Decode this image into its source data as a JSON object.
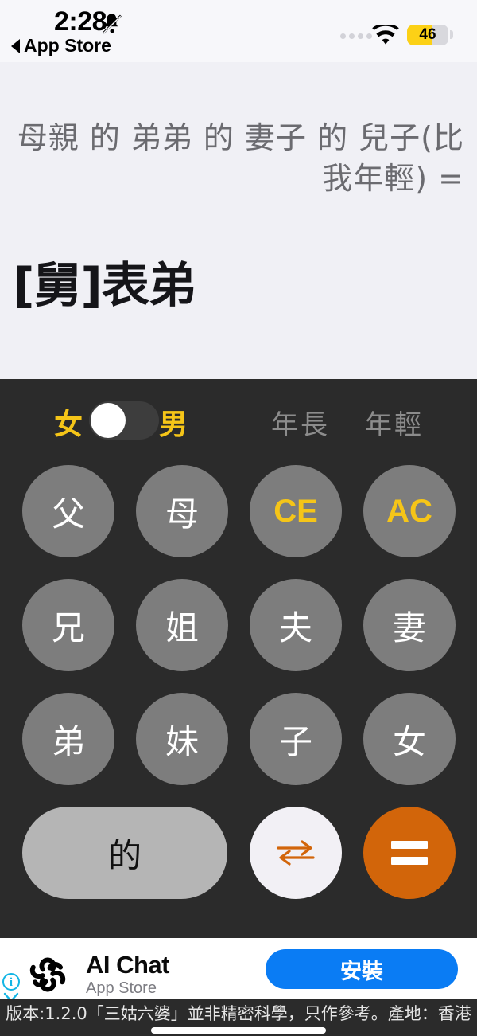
{
  "statusbar": {
    "time": "2:28",
    "bell_icon": "bell-slash-icon",
    "back_label": "App Store",
    "back_icon": "triangle-left-icon",
    "wifi_icon": "wifi-icon",
    "battery_percent": "46",
    "battery_fill_color": "#fcd116",
    "signal_dots": 4
  },
  "display": {
    "expression": "母親 的 弟弟 的 妻子 的 兒子(比我年輕) =",
    "result": "[舅]表弟",
    "background_color": "#f0f0f5",
    "expression_color": "#6b6b70",
    "result_color": "#151519"
  },
  "toggle_row": {
    "female_label": "女",
    "male_label": "男",
    "switch_position": "left",
    "older_label": "年長",
    "younger_label": "年輕",
    "active_color": "#f5c518",
    "inactive_color": "#8c8c8c"
  },
  "keypad": {
    "background_color": "#2b2b2b",
    "key_color": "#7d7d7d",
    "accent_color": "#f5c518",
    "keys": [
      {
        "label": "父",
        "style": "normal"
      },
      {
        "label": "母",
        "style": "normal"
      },
      {
        "label": "CE",
        "style": "accent"
      },
      {
        "label": "AC",
        "style": "accent"
      },
      {
        "label": "兄",
        "style": "normal"
      },
      {
        "label": "姐",
        "style": "normal"
      },
      {
        "label": "夫",
        "style": "normal"
      },
      {
        "label": "妻",
        "style": "normal"
      },
      {
        "label": "弟",
        "style": "normal"
      },
      {
        "label": "妹",
        "style": "normal"
      },
      {
        "label": "子",
        "style": "normal"
      },
      {
        "label": "女",
        "style": "normal"
      }
    ],
    "de_label": "的",
    "swap_icon": "swap-arrows-icon",
    "swap_icon_color": "#d2650a",
    "equals_label": "=",
    "equals_color": "#d2650a"
  },
  "ad": {
    "info_icon": "info-icon",
    "chevron_icon": "chevron-down-icon",
    "app_icon": "openai-flower-icon",
    "title": "AI Chat",
    "subtitle": "App Store",
    "cta_label": "安裝",
    "cta_color": "#0a7cf4"
  },
  "footer": {
    "text": "版本:1.2.0「三姑六婆」並非精密科學，只作參考。產地：香港",
    "home_indicator": "home-indicator"
  }
}
